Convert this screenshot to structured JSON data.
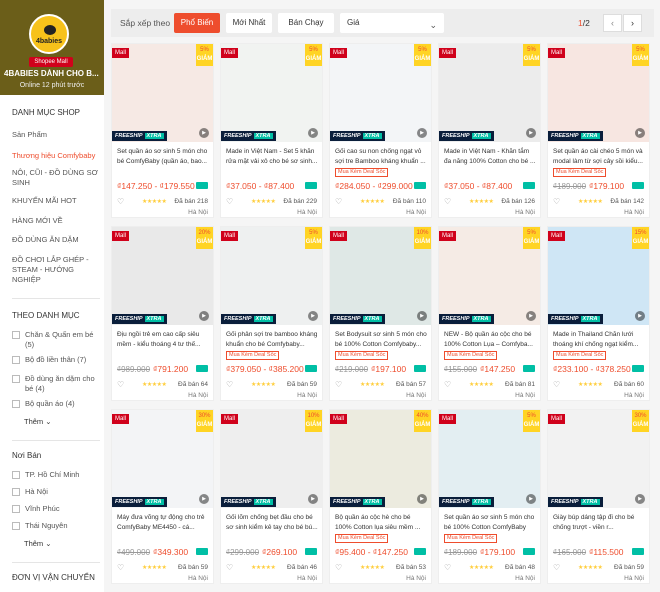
{
  "shop": {
    "logo_text": "4babies",
    "mall_label": "Shopee Mall",
    "name": "4BABIES DÀNH CHO B...",
    "online": "Online 12 phút trước"
  },
  "sidebar": {
    "category_title": "DANH MỤC SHOP",
    "categories": [
      "Sản Phẩm",
      "Thương hiệu Comfybaby",
      "NÔI, CŨI - ĐỒ DÙNG SƠ SINH",
      "KHUYẾN MÃI HOT",
      "HÀNG MỚI VỀ",
      "ĐỒ DÙNG ĂN DẶM",
      "ĐỒ CHƠI LẮP GHÉP - STEAM - HƯỚNG NGHIỆP"
    ],
    "filter_title": "THEO DANH MỤC",
    "filters": [
      "Chăn & Quấn em bé (5)",
      "Bộ đồ liền thân (7)",
      "Đồ dùng ăn dặm cho bé (4)",
      "Bộ quần áo (4)"
    ],
    "more_label": "Thêm",
    "location_title": "Nơi Bán",
    "locations": [
      "TP. Hồ Chí Minh",
      "Hà Nội",
      "Vĩnh Phúc",
      "Thái Nguyên"
    ],
    "more_label2": "Thêm",
    "shipping_title": "ĐƠN VỊ VẬN CHUYỂN"
  },
  "sortbar": {
    "label": "Sắp xếp theo",
    "options": [
      "Phổ Biến",
      "Mới Nhất",
      "Bán Chạy"
    ],
    "price_label": "Giá",
    "page_current": "1",
    "page_total": "/2",
    "prev": "‹",
    "next": "›"
  },
  "labels": {
    "mall": "Mall",
    "giam": "GIẢM",
    "freeship": "FREESHIP",
    "xtra": "XTRA",
    "deal": "Mua Kèm Deal Sốc",
    "stars": "★★★★★"
  },
  "products": [
    {
      "name": "Set quần áo sơ sinh 5 món cho bé ComfyBaby (quần áo, bao...",
      "discount": "5%",
      "old": "",
      "price": "₫147.250 - ₫179.550",
      "sold": "Đã bán 218",
      "loc": "Hà Nội",
      "deal": false,
      "bg": "#f6e9e4"
    },
    {
      "name": "Made in Việt Nam - Set 5 khăn rửa mặt vải xô cho bé sơ sinh...",
      "discount": "5%",
      "old": "",
      "price": "₫37.050 - ₫87.400",
      "sold": "Đã bán 229",
      "loc": "Hà Nội",
      "deal": false,
      "bg": "#f1f3f1"
    },
    {
      "name": "Gối cao su non chống ngạt vỏ sợi tre Bamboo kháng khuẩn ...",
      "discount": "5%",
      "old": "",
      "price": "₫284.050 - ₫299.000",
      "sold": "Đã bán 110",
      "loc": "Hà Nội",
      "deal": true,
      "bg": "#f3f5f7"
    },
    {
      "name": "Made in Việt Nam - Khăn tắm đa năng 100% Cotton cho bé ...",
      "discount": "5%",
      "old": "",
      "price": "₫37.050 - ₫87.400",
      "sold": "Đã bán 126",
      "loc": "Hà Nội",
      "deal": false,
      "bg": "#ececec"
    },
    {
      "name": "Set quần áo cài chéo 5 món và modal làm từ sợi cây sồi kiểu...",
      "discount": "5%",
      "old": "₫189.000",
      "price": "₫179.100",
      "sold": "Đã bán 142",
      "loc": "Hà Nội",
      "deal": true,
      "bg": "#f7e6e1"
    },
    {
      "name": "Địu ngồi trẻ em cao cấp siêu mềm - kiểu thoáng 4 tư thế...",
      "discount": "20%",
      "old": "₫989.000",
      "price": "₫791.200",
      "sold": "Đã bán 64",
      "loc": "Hà Nội",
      "deal": false,
      "bg": "#e9e9e9"
    },
    {
      "name": "Gối phân sợi tre bamboo kháng khuẩn cho bé Comfybaby...",
      "discount": "5%",
      "old": "",
      "price": "₫379.050 - ₫385.200",
      "sold": "Đã bán 59",
      "loc": "Hà Nội",
      "deal": true,
      "bg": "#eef0f0"
    },
    {
      "name": "Set Bodysuit sơ sinh 5 món cho bé 100% Cotton Comfybaby...",
      "discount": "10%",
      "old": "₫219.000",
      "price": "₫197.100",
      "sold": "Đã bán 57",
      "loc": "Hà Nội",
      "deal": true,
      "bg": "#dfe8e6"
    },
    {
      "name": "NEW - Bộ quần áo cộc cho bé 100% Cotton Lụa – Comfyba...",
      "discount": "5%",
      "old": "₫155.000",
      "price": "₫147.250",
      "sold": "Đã bán 81",
      "loc": "Hà Nội",
      "deal": true,
      "bg": "#f5ebe5"
    },
    {
      "name": "Made in Thailand Chăn lưới thoáng khí chống ngạt kiểm...",
      "discount": "15%",
      "old": "",
      "price": "₫233.100 - ₫378.250",
      "sold": "Đã bán 60",
      "loc": "Hà Nội",
      "deal": true,
      "bg": "#cfe6f5"
    },
    {
      "name": "Máy đưa võng tự động cho trẻ ComfyBaby ME4450 - cá...",
      "discount": "30%",
      "old": "₫499.000",
      "price": "₫349.300",
      "sold": "Đã bán 59",
      "loc": "Hà Nội",
      "deal": false,
      "bg": "#f3f4f6"
    },
    {
      "name": "Gối lõm chống bẹt đầu cho bé sơ sinh kiểm kê tay cho bé bú...",
      "discount": "10%",
      "old": "₫299.000",
      "price": "₫269.100",
      "sold": "Đã bán 46",
      "loc": "Hà Nội",
      "deal": false,
      "bg": "#eeeeee"
    },
    {
      "name": "Bộ quần áo cộc hè cho bé 100% Cotton lụa siêu mềm ...",
      "discount": "40%",
      "old": "",
      "price": "₫95.400 - ₫147.250",
      "sold": "Đã bán 53",
      "loc": "Hà Nội",
      "deal": true,
      "bg": "#ecebdf"
    },
    {
      "name": "Set quần áo sơ sinh 5 món cho bé 100% Cotton ComfyBaby (quần áo, bao...",
      "discount": "5%",
      "old": "₫189.000",
      "price": "₫179.100",
      "sold": "Đã bán 48",
      "loc": "Hà Nội",
      "deal": true,
      "bg": "#e3eef2"
    },
    {
      "name": "Giày búp dáng tập đi cho bé chống trượt - viền r...",
      "discount": "30%",
      "old": "₫165.000",
      "price": "₫115.500",
      "sold": "Đã bán 59",
      "loc": "Hà Nội",
      "deal": false,
      "bg": "#f2f2f2"
    }
  ]
}
